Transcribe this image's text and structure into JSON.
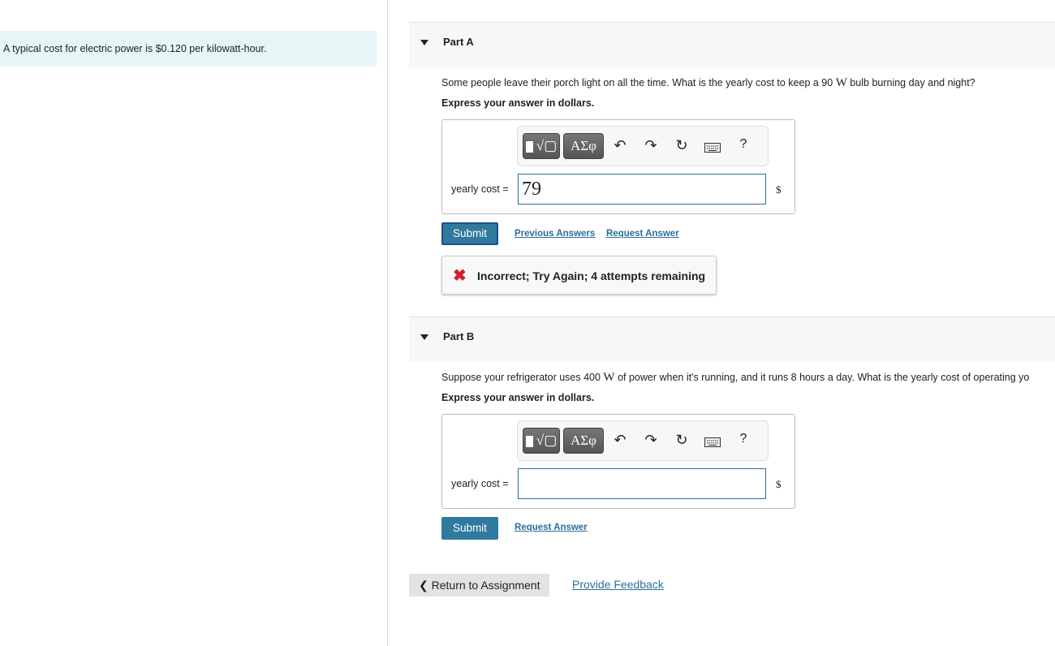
{
  "intro": "A typical cost for electric power is $0.120 per kilowatt-hour.",
  "parts": [
    {
      "label": "Part A",
      "question_pre": "Some people leave their porch light on all the time. What is the yearly cost to keep a 90 ",
      "question_unit": "W",
      "question_post": " bulb burning day and night?",
      "express": "Express your answer in dollars.",
      "field_label": "yearly cost =",
      "value": "79",
      "unit": "$",
      "submit": "Submit",
      "previous_answers": "Previous Answers",
      "request_answer": "Request Answer",
      "feedback": "Incorrect; Try Again; 4 attempts remaining"
    },
    {
      "label": "Part B",
      "question_pre": "Suppose your refrigerator uses 400 ",
      "question_unit": "W",
      "question_post": " of power when it's running, and it runs 8 hours a day. What is the yearly cost of operating yo",
      "express": "Express your answer in dollars.",
      "field_label": "yearly cost =",
      "value": "",
      "unit": "$",
      "submit": "Submit",
      "request_answer": "Request Answer"
    }
  ],
  "toolbar": {
    "greek": "ΑΣφ",
    "help": "?"
  },
  "footer": {
    "return": "Return to Assignment",
    "feedback": "Provide Feedback"
  }
}
